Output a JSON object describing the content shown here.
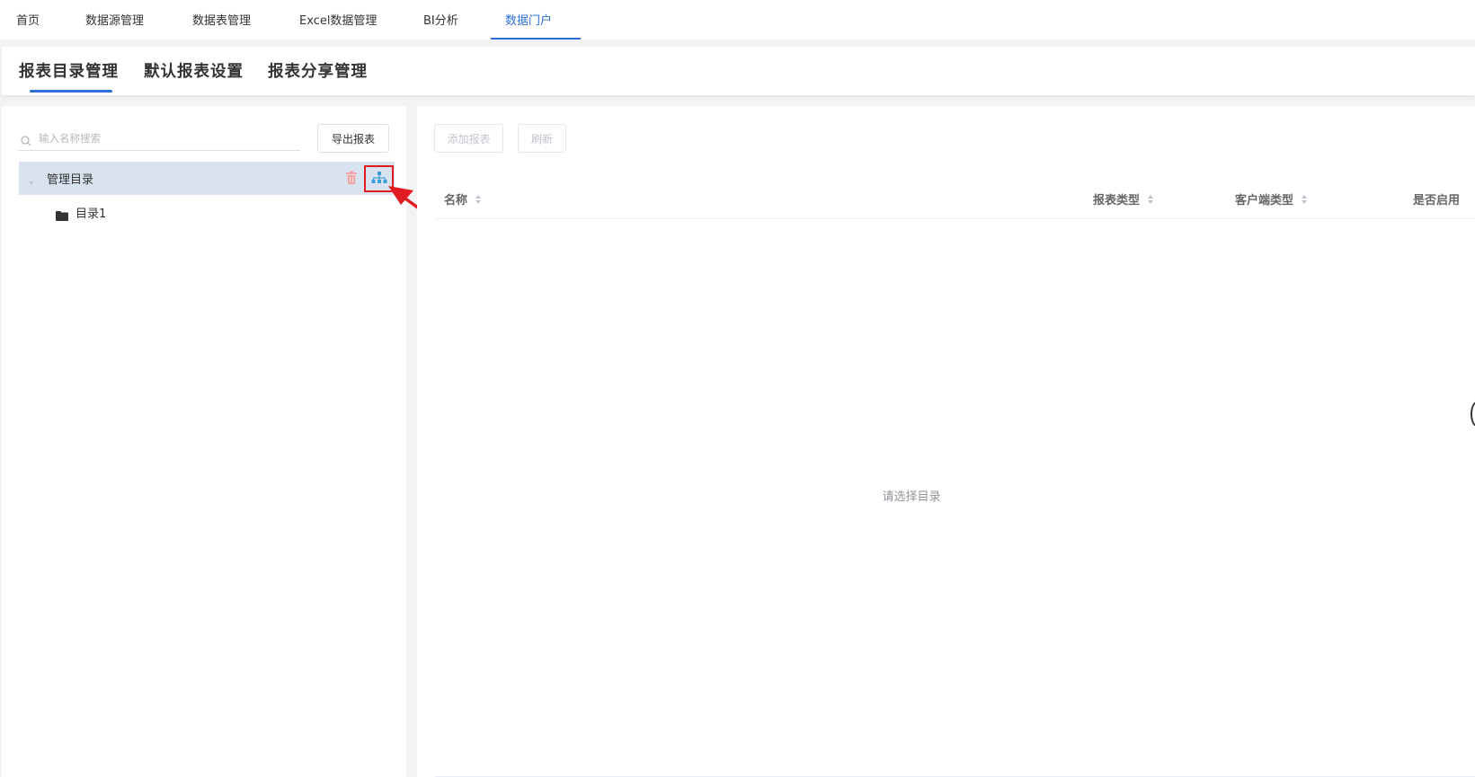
{
  "topnav": {
    "items": [
      {
        "label": "首页",
        "active": false
      },
      {
        "label": "数据源管理",
        "active": false
      },
      {
        "label": "数据表管理",
        "active": false
      },
      {
        "label": "Excel数据管理",
        "active": false
      },
      {
        "label": "BI分析",
        "active": false
      },
      {
        "label": "数据门户",
        "active": true
      }
    ],
    "active_color": "#2c6fd9"
  },
  "subtabs": {
    "items": [
      "报表目录管理",
      "默认报表设置",
      "报表分享管理"
    ],
    "active_index": 0
  },
  "left_panel": {
    "search": {
      "placeholder": "输入名称搜索",
      "value": ""
    },
    "export_label": "导出报表",
    "tree": {
      "root_label": "管理目录",
      "children": [
        "目录1"
      ]
    },
    "icons": {
      "search": "search-icon",
      "caret": "caret-down-icon",
      "delete": "trash-icon",
      "org": "org-chart-icon",
      "folder": "folder-icon"
    }
  },
  "right_panel": {
    "toolbar": {
      "add_label": "添加报表",
      "refresh_label": "刷新"
    },
    "table": {
      "columns": [
        "名称",
        "报表类型",
        "客户端类型",
        "是否启用"
      ],
      "empty_text": "请选择目录"
    }
  },
  "colors": {
    "highlight_border": "#e11b22",
    "selected_row": "#d9e3ef",
    "annotation_arrow": "#e11b22"
  }
}
